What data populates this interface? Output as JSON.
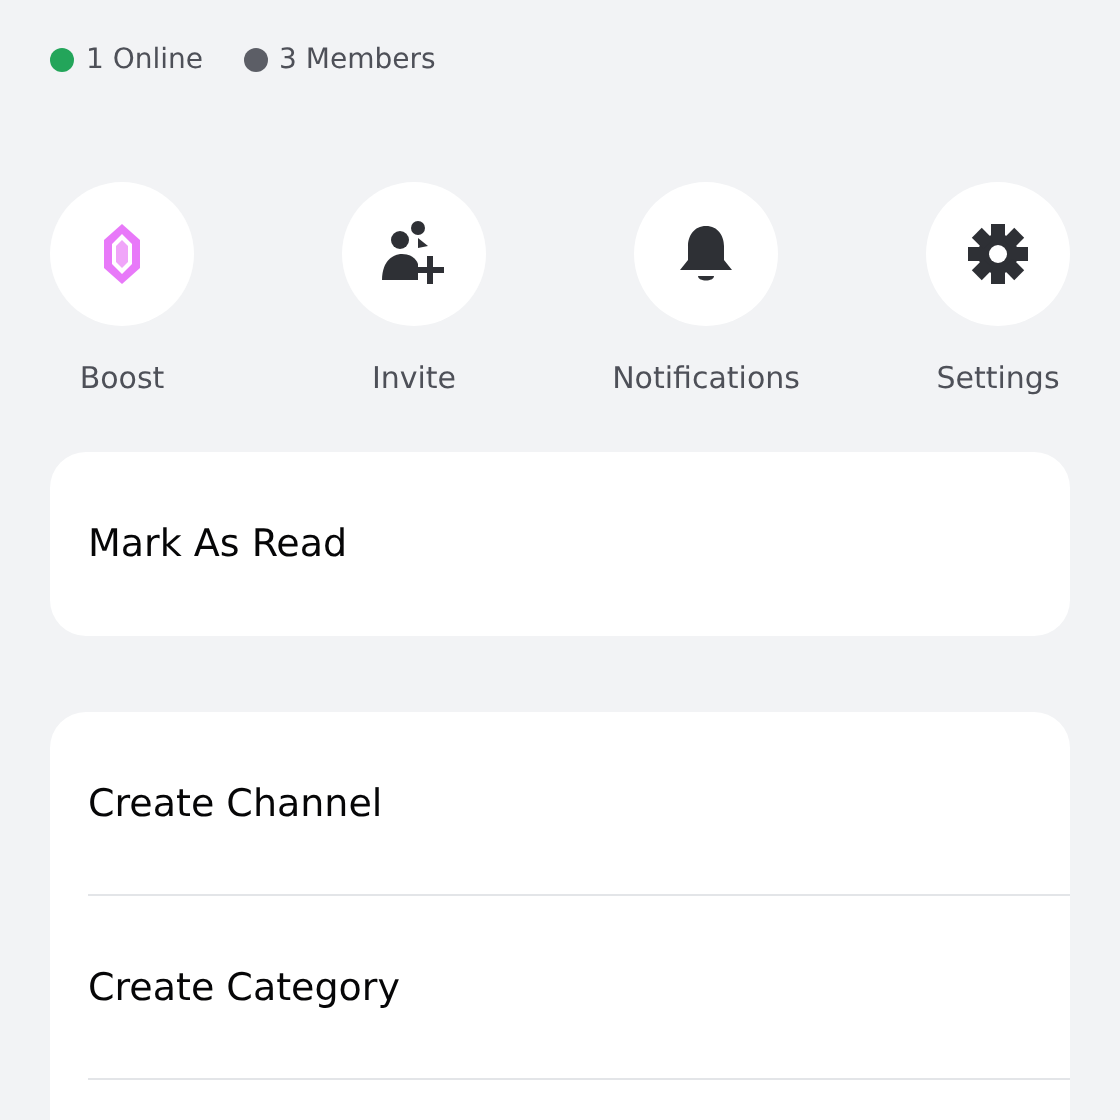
{
  "stats": [
    {
      "label": "1 Online",
      "color": "#23a55a"
    },
    {
      "label": "3 Members",
      "color": "#5c5e66"
    }
  ],
  "actions": [
    {
      "kind": "boost",
      "label": "Boost"
    },
    {
      "kind": "invite",
      "label": "Invite"
    },
    {
      "kind": "notifications",
      "label": "Notifications"
    },
    {
      "kind": "settings",
      "label": "Settings"
    }
  ],
  "menu_groups": [
    {
      "items": [
        {
          "label": "Mark As Read"
        }
      ]
    },
    {
      "items": [
        {
          "label": "Create Channel"
        },
        {
          "label": "Create Category"
        }
      ]
    }
  ]
}
